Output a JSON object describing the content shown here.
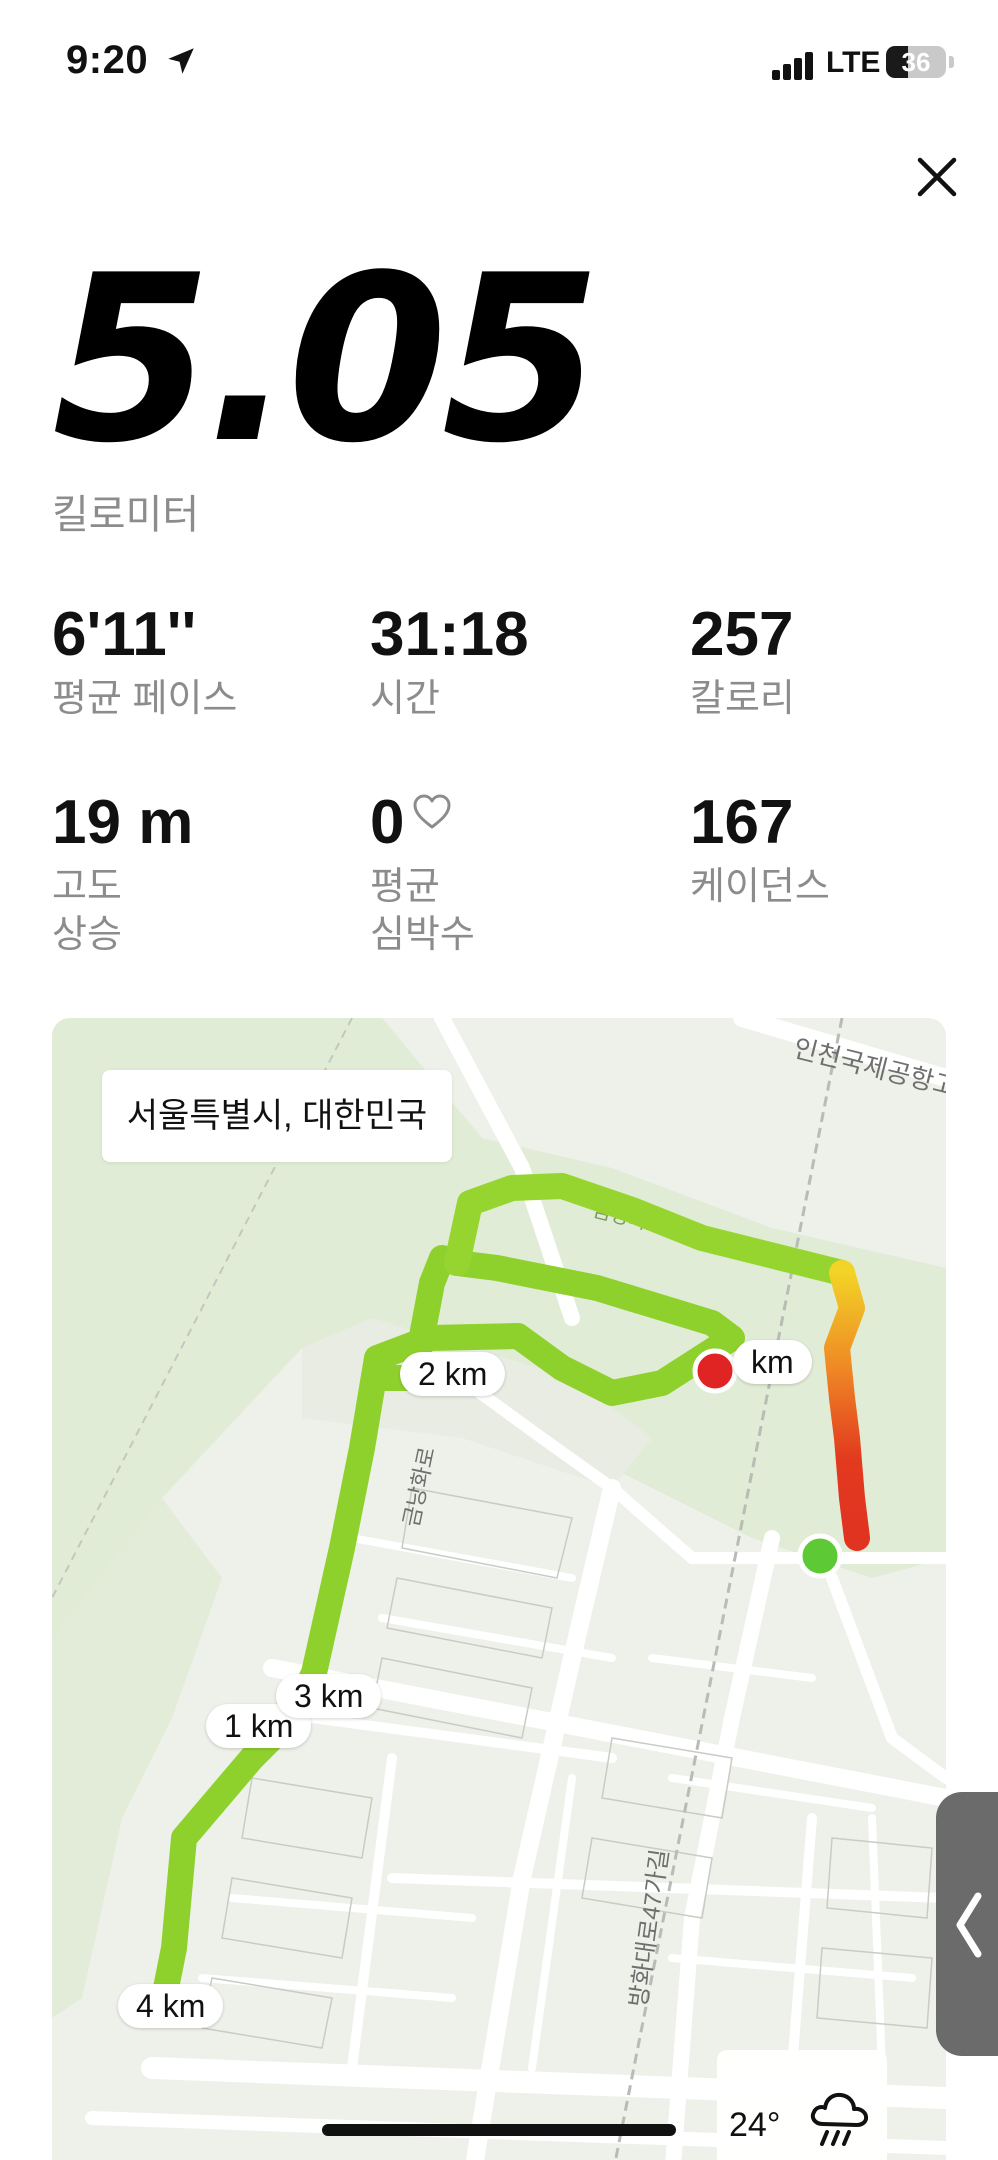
{
  "status_bar": {
    "time": "9:20",
    "network": "LTE",
    "battery": "36",
    "battery_level_percent": 36
  },
  "summary": {
    "distance": "5.05",
    "distance_unit": "킬로미터"
  },
  "stats": [
    {
      "value": "6'11''",
      "label": "평균 페이스"
    },
    {
      "value": "31:18",
      "label": "시간"
    },
    {
      "value": "257",
      "label": "칼로리"
    },
    {
      "value": "19 m",
      "label": "고도\n상승"
    },
    {
      "value": "0",
      "label": "평균\n심박수"
    },
    {
      "value": "167",
      "label": "케이던스"
    }
  ],
  "map": {
    "location": "서울특별시, 대한민국",
    "street_labels": [
      "인천국제공항고",
      "금낭화로26가길",
      "금낭화로",
      "방화대로47가길"
    ],
    "km_markers": [
      "km",
      "1 km",
      "2 km",
      "3 km",
      "4 km"
    ],
    "route_colors": {
      "fast": "#8fd12c",
      "medium": "#f2d326",
      "slow": "#e23a1f",
      "start": "#5cc935",
      "end": "#e02424"
    },
    "weather": {
      "temperature": "24°",
      "icon": "rain-cloud-icon"
    }
  },
  "icons": [
    "location-arrow-icon",
    "close-icon",
    "heart-icon",
    "rain-cloud-icon",
    "chevron-left-icon"
  ]
}
